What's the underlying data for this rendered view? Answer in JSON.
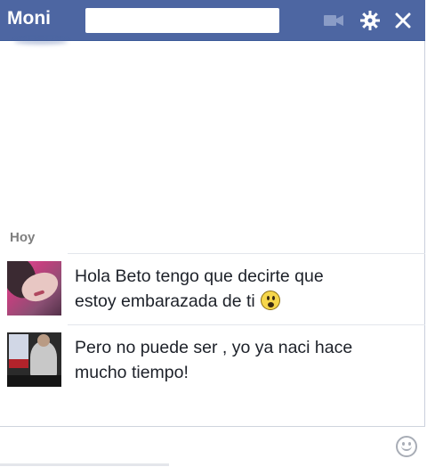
{
  "header": {
    "name": "Moni",
    "icons": [
      "video-camera-icon",
      "gear-icon",
      "close-icon"
    ],
    "background_color": "#4d66a2"
  },
  "conversation": {
    "date_label": "Hoy",
    "messages": [
      {
        "text": "Hola Beto tengo que decirte que\nestoy embarazada de ti",
        "emoji": "surprised-face-icon",
        "avatar": "sender-avatar-pink-photo"
      },
      {
        "text": "Pero no puede ser , yo ya naci hace\nmucho tiempo!",
        "avatar": "sender-avatar-man-photo"
      }
    ]
  },
  "composer": {
    "value": "",
    "emoji_button_icon": "smiley-icon"
  }
}
